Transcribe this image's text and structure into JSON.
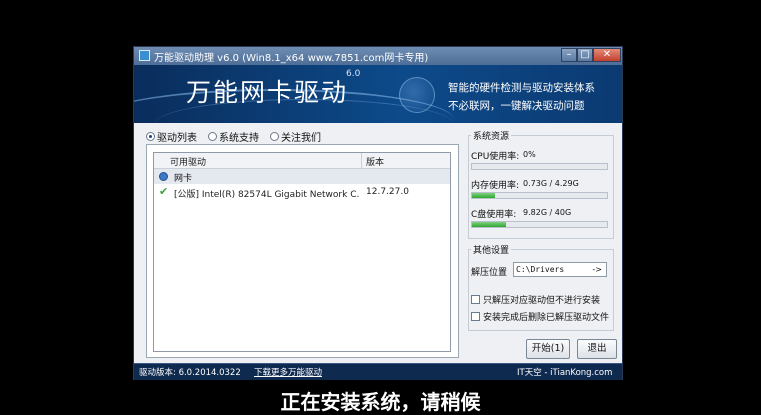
{
  "window": {
    "title": "万能驱动助理 v6.0 (Win8.1_x64 www.7851.com网卡专用)",
    "controls": {
      "minimize": "–",
      "maximize": "□",
      "close": "✕"
    }
  },
  "banner": {
    "title": "万能网卡驱动",
    "version": "6.0",
    "tagline_1": "智能的硬件检测与驱动安装体系",
    "tagline_2": "不必联网，一键解决驱动问题"
  },
  "tabs": [
    {
      "label": "驱动列表",
      "selected": true
    },
    {
      "label": "系统支持",
      "selected": false
    },
    {
      "label": "关注我们",
      "selected": false
    }
  ],
  "driver_list": {
    "columns": [
      "可用驱动",
      "版本"
    ],
    "group": "网卡",
    "rows": [
      {
        "name": "[公版] Intel(R) 82574L Gigabit Network C...",
        "version": "12.7.27.0",
        "checked": true
      }
    ]
  },
  "system_resources": {
    "title": "系统资源",
    "cpu": {
      "label": "CPU使用率:",
      "value": "0%",
      "percent": 0
    },
    "memory": {
      "label": "内存使用率:",
      "value": "0.73G / 4.29G",
      "percent": 17
    },
    "disk": {
      "label": "C盘使用率:",
      "value": "9.82G / 40G",
      "percent": 25
    }
  },
  "other_settings": {
    "title": "其他设置",
    "path_label": "解压位置",
    "path_value": "C:\\Drivers",
    "path_arrow": "->",
    "option_1": {
      "label": "只解压对应驱动但不进行安装",
      "checked": false
    },
    "option_2": {
      "label": "安装完成后删除已解压驱动文件",
      "checked": false
    }
  },
  "buttons": {
    "start": "开始(1)",
    "exit": "退出"
  },
  "statusbar": {
    "version": "驱动版本: 6.0.2014.0322",
    "download_link": "下载更多万能驱动",
    "site": "IT天空 - iTianKong.com"
  },
  "caption": "正在安装系统，请稍候",
  "colors": {
    "accent": "#0d4a8a",
    "progress": "#2fa62f"
  },
  "icons": {
    "group": "network-card-icon",
    "row_status": "checkmark-icon"
  }
}
